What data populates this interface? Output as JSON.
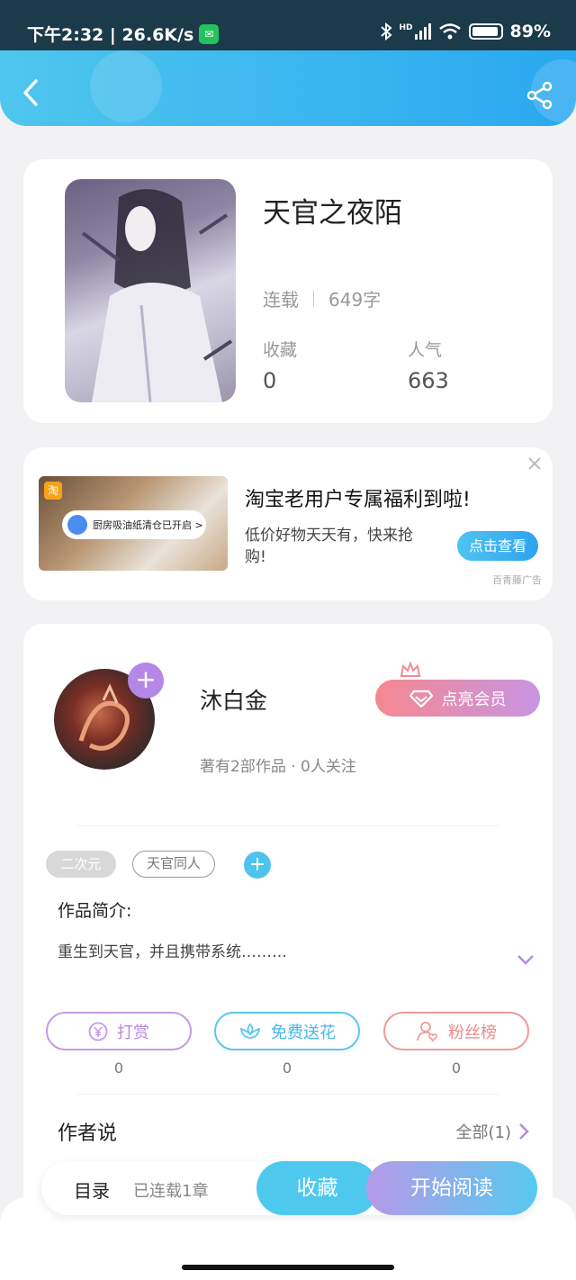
{
  "status_bar": {
    "time_and_speed": "下午2:32 | 26.6K/s",
    "battery": "89%",
    "network_badge": "HD"
  },
  "header": {
    "back_icon": "chevron-left-icon",
    "share_icon": "share-icon"
  },
  "book": {
    "title": "天官之夜陌",
    "status": "连载",
    "word_count": "649字",
    "favorites_label": "收藏",
    "favorites_value": "0",
    "popularity_label": "人气",
    "popularity_value": "663"
  },
  "ad": {
    "badge": "淘",
    "toast_text": "厨房吸油纸清仓已开启 >",
    "title": "淘宝老用户专属福利到啦!",
    "description": "低价好物天天有，快来抢购!",
    "button": "点击查看",
    "source": "百青藤广告"
  },
  "author": {
    "name": "沐白金",
    "follow_button": "+",
    "info": "著有2部作品 · 0人关注",
    "vip_button": "点亮会员"
  },
  "tags": [
    "二次元",
    "天官同人"
  ],
  "tag_add": "+",
  "intro": {
    "label": "作品简介:",
    "text": "重生到天官，并且携带系统………"
  },
  "actions": [
    {
      "label": "打赏",
      "count": "0",
      "icon": "yen-coin-icon"
    },
    {
      "label": "免费送花",
      "count": "0",
      "icon": "flower-icon"
    },
    {
      "label": "粉丝榜",
      "count": "0",
      "icon": "user-heart-icon"
    }
  ],
  "author_say": {
    "label": "作者说",
    "all_link": "全部(1)"
  },
  "bottom_bar": {
    "toc": "目录",
    "serial": "已连载1章",
    "collect": "收藏",
    "read": "开始阅读"
  },
  "colors": {
    "header_start": "#4fc6ee",
    "header_end": "#2aa8f0",
    "accent_purple": "#b487e8",
    "accent_blue": "#4fc8ee",
    "vip_gradient_start": "#f5888f",
    "vip_gradient_end": "#c895e3"
  }
}
